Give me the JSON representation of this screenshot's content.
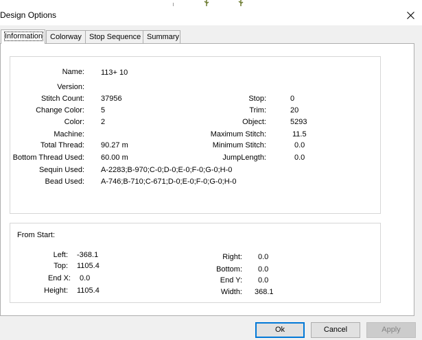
{
  "window": {
    "title": "Design Options"
  },
  "tabs": [
    {
      "label": "Information",
      "active": true
    },
    {
      "label": "Colorway",
      "active": false
    },
    {
      "label": "Stop Sequence",
      "active": false
    },
    {
      "label": "Summary",
      "active": false
    }
  ],
  "info": {
    "name": {
      "label": "Name:",
      "value": "113+ 10"
    },
    "version": {
      "label": "Version:",
      "value": ""
    },
    "stitch_count": {
      "label": "Stitch Count:",
      "value": "37956"
    },
    "change_color": {
      "label": "Change Color:",
      "value": "5"
    },
    "color": {
      "label": "Color:",
      "value": "2"
    },
    "machine": {
      "label": "Machine:",
      "value": ""
    },
    "total_thread": {
      "label": "Total Thread:",
      "value": "90.27 m"
    },
    "bottom_thread": {
      "label": "Bottom Thread Used:",
      "value": "60.00 m"
    },
    "sequin": {
      "label": "Sequin Used:",
      "value": "A-2283;B-970;C-0;D-0;E-0;F-0;G-0;H-0"
    },
    "bead": {
      "label": "Bead Used:",
      "value": "A-746;B-710;C-671;D-0;E-0;F-0;G-0;H-0"
    },
    "stop": {
      "label": "Stop:",
      "value": "0"
    },
    "trim": {
      "label": "Trim:",
      "value": "20"
    },
    "object": {
      "label": "Object:",
      "value": "5293"
    },
    "max_stitch": {
      "label": "Maximum Stitch:",
      "value": "11.5"
    },
    "min_stitch": {
      "label": "Minimum Stitch:",
      "value": "0.0"
    },
    "jump_length": {
      "label": "JumpLength:",
      "value": "0.0"
    }
  },
  "from_start": {
    "title": "From Start:",
    "left": {
      "label": "Left:",
      "value": "-368.1"
    },
    "top": {
      "label": "Top:",
      "value": "1105.4"
    },
    "end_x": {
      "label": "End X:",
      "value": "0.0"
    },
    "height": {
      "label": "Height:",
      "value": "1105.4"
    },
    "right": {
      "label": "Right:",
      "value": "0.0"
    },
    "bottom": {
      "label": "Bottom:",
      "value": "0.0"
    },
    "end_y": {
      "label": "End Y:",
      "value": "0.0"
    },
    "width": {
      "label": "Width:",
      "value": "368.1"
    }
  },
  "buttons": {
    "ok": "Ok",
    "cancel": "Cancel",
    "apply": "Apply"
  },
  "icons": {
    "close": "close-icon"
  }
}
